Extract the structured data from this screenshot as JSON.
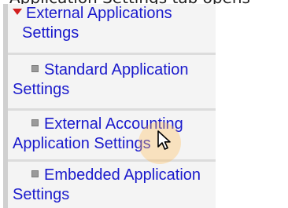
{
  "header": {
    "cut_off_text": "Application Settings tab opens"
  },
  "menu": {
    "items": [
      {
        "line1": "External Applications",
        "line2": "Settings",
        "expanded": true
      },
      {
        "line1": "Standard Application",
        "line2": "Settings",
        "expanded": false
      },
      {
        "line1": "External Accounting",
        "line2": "Application Settings",
        "expanded": false
      },
      {
        "line1": "Embedded Application",
        "line2": "Settings",
        "expanded": false
      }
    ]
  },
  "colors": {
    "link": "#1a1acc",
    "caret": "#d21f1f",
    "item_bg": "#f4f4f4",
    "separator": "#dcdcdc"
  }
}
